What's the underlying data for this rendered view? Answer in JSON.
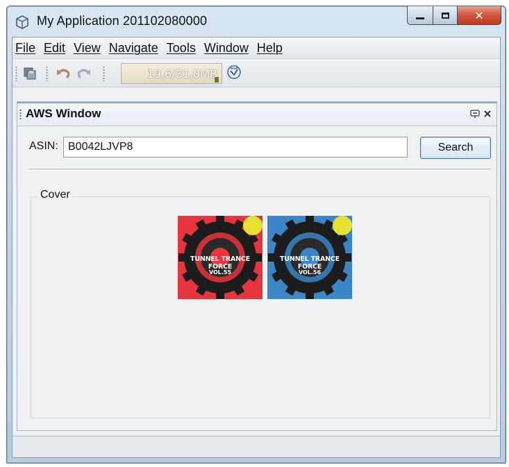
{
  "window": {
    "title": "My Application 201102080000",
    "controls": {
      "minimize": "minimize",
      "maximize": "maximize",
      "close": "close"
    }
  },
  "menu": {
    "items": [
      "File",
      "Edit",
      "View",
      "Navigate",
      "Tools",
      "Window",
      "Help"
    ]
  },
  "toolbar": {
    "icons": [
      "save-all-icon",
      "undo-icon",
      "redo-icon",
      "garbage-collect-icon"
    ],
    "memory": "19,6/31,0MB"
  },
  "panel": {
    "title": "AWS Window",
    "asin_label": "ASIN:",
    "asin_value": "B0042LJVP8",
    "search_label": "Search",
    "cover_label": "Cover",
    "covers": [
      {
        "title": "TUNNEL TRANCE FORCE",
        "volume": "VOL.55",
        "color": "#e8343c"
      },
      {
        "title": "TUNNEL TRANCE FORCE",
        "volume": "VOL.56",
        "color": "#3a86c6"
      }
    ]
  }
}
